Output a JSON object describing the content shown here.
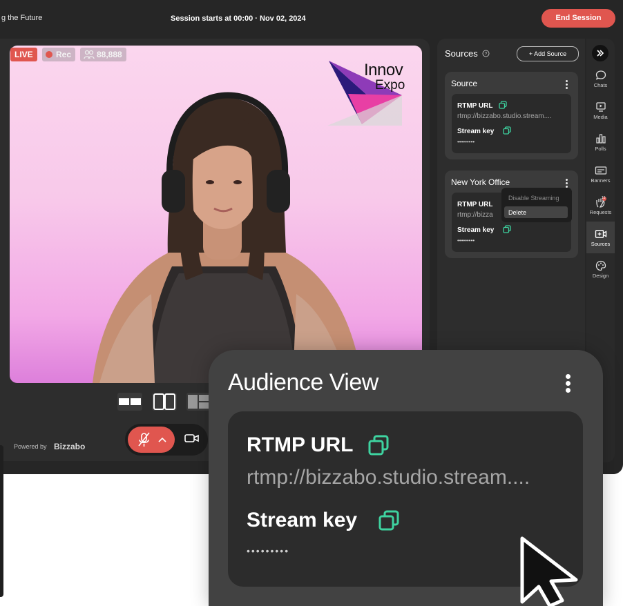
{
  "header": {
    "event_title": "g the Future",
    "session_text": "Session starts at 00:00 · Nov 02, 2024",
    "end_session_label": "End Session"
  },
  "stage": {
    "live_label": "LIVE",
    "rec_label": "Rec",
    "viewer_count": "88,888",
    "logo_line1": "Innov",
    "logo_line2": "Expo",
    "powered_by": "Powered by",
    "brand": "Bizzabo"
  },
  "sources": {
    "title": "Sources",
    "add_source_label": "+ Add Source",
    "cards": [
      {
        "title": "Source",
        "rtmp_label": "RTMP URL",
        "rtmp_value": "rtmp://bizzabo.studio.stream....",
        "key_label": "Stream key",
        "key_value": "•••••••••"
      },
      {
        "title": "New York Office",
        "rtmp_label": "RTMP URL",
        "rtmp_value": "rtmp://bizza",
        "key_label": "Stream key",
        "key_value": "•••••••••"
      }
    ],
    "context_menu": {
      "disable_label": "Disable Streaming",
      "delete_label": "Delete"
    }
  },
  "rail": {
    "items": [
      {
        "label": "Chats",
        "icon": "chat-icon"
      },
      {
        "label": "Media",
        "icon": "media-icon"
      },
      {
        "label": "Polls",
        "icon": "polls-icon"
      },
      {
        "label": "Banners",
        "icon": "banners-icon"
      },
      {
        "label": "Requests",
        "icon": "hand-icon",
        "badge": "15"
      },
      {
        "label": "Sources",
        "icon": "sources-icon",
        "active": true
      },
      {
        "label": "Design",
        "icon": "palette-icon"
      }
    ]
  },
  "audience_view": {
    "title": "Audience View",
    "rtmp_label": "RTMP URL",
    "rtmp_value": "rtmp://bizzabo.studio.stream....",
    "key_label": "Stream key",
    "key_value": "•••••••••"
  },
  "colors": {
    "accent_red": "#e0564f",
    "copy_icon_green": "#3ed3a0",
    "panel_dark": "#262626"
  }
}
